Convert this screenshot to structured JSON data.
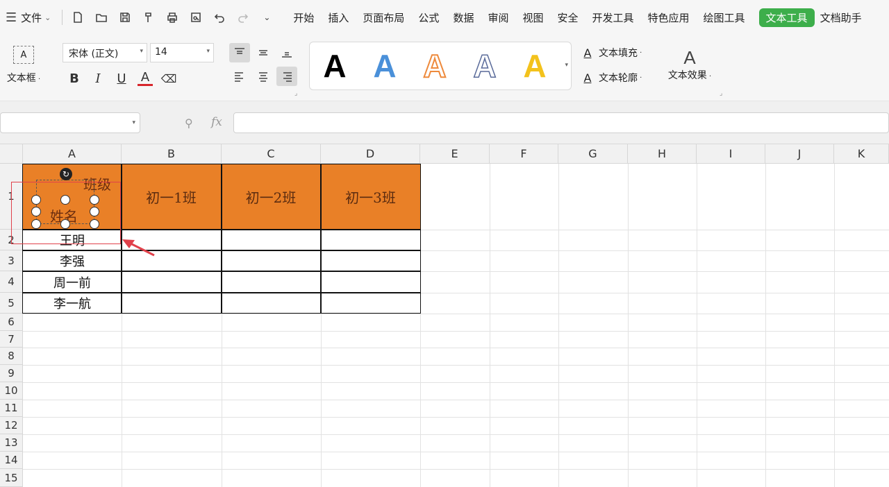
{
  "menubar": {
    "file_label": "文件",
    "tabs": [
      "开始",
      "插入",
      "页面布局",
      "公式",
      "数据",
      "审阅",
      "视图",
      "安全",
      "开发工具",
      "特色应用",
      "绘图工具",
      "文本工具",
      "文档助手"
    ],
    "active_tab": "文本工具"
  },
  "ribbon": {
    "textbox_label": "文本框",
    "textbox_icon_text": "A",
    "font_name": "宋体 (正文)",
    "font_size": "14",
    "bold": "B",
    "italic": "I",
    "underline": "U",
    "font_color_glyph": "A",
    "wordart_glyph": "A",
    "text_fill": "文本填充",
    "text_outline": "文本轮廓",
    "text_effect": "文本效果",
    "accent": "#3dae4b"
  },
  "formula_bar": {
    "fx": "fx",
    "value": ""
  },
  "grid": {
    "columns": [
      "A",
      "B",
      "C",
      "D",
      "E",
      "F",
      "G",
      "H",
      "I",
      "J",
      "K"
    ],
    "rows": [
      "1",
      "2",
      "3",
      "4",
      "5",
      "6",
      "7",
      "8",
      "9",
      "10",
      "11",
      "12",
      "13",
      "14",
      "15"
    ],
    "a1_top_right": "班级",
    "a1_bottom_left": "姓名",
    "class_headers": [
      "初一1班",
      "初一2班",
      "初一3班"
    ],
    "names": [
      "王明",
      "李强",
      "周一前",
      "李一航"
    ],
    "header_fill": "#e98027"
  }
}
